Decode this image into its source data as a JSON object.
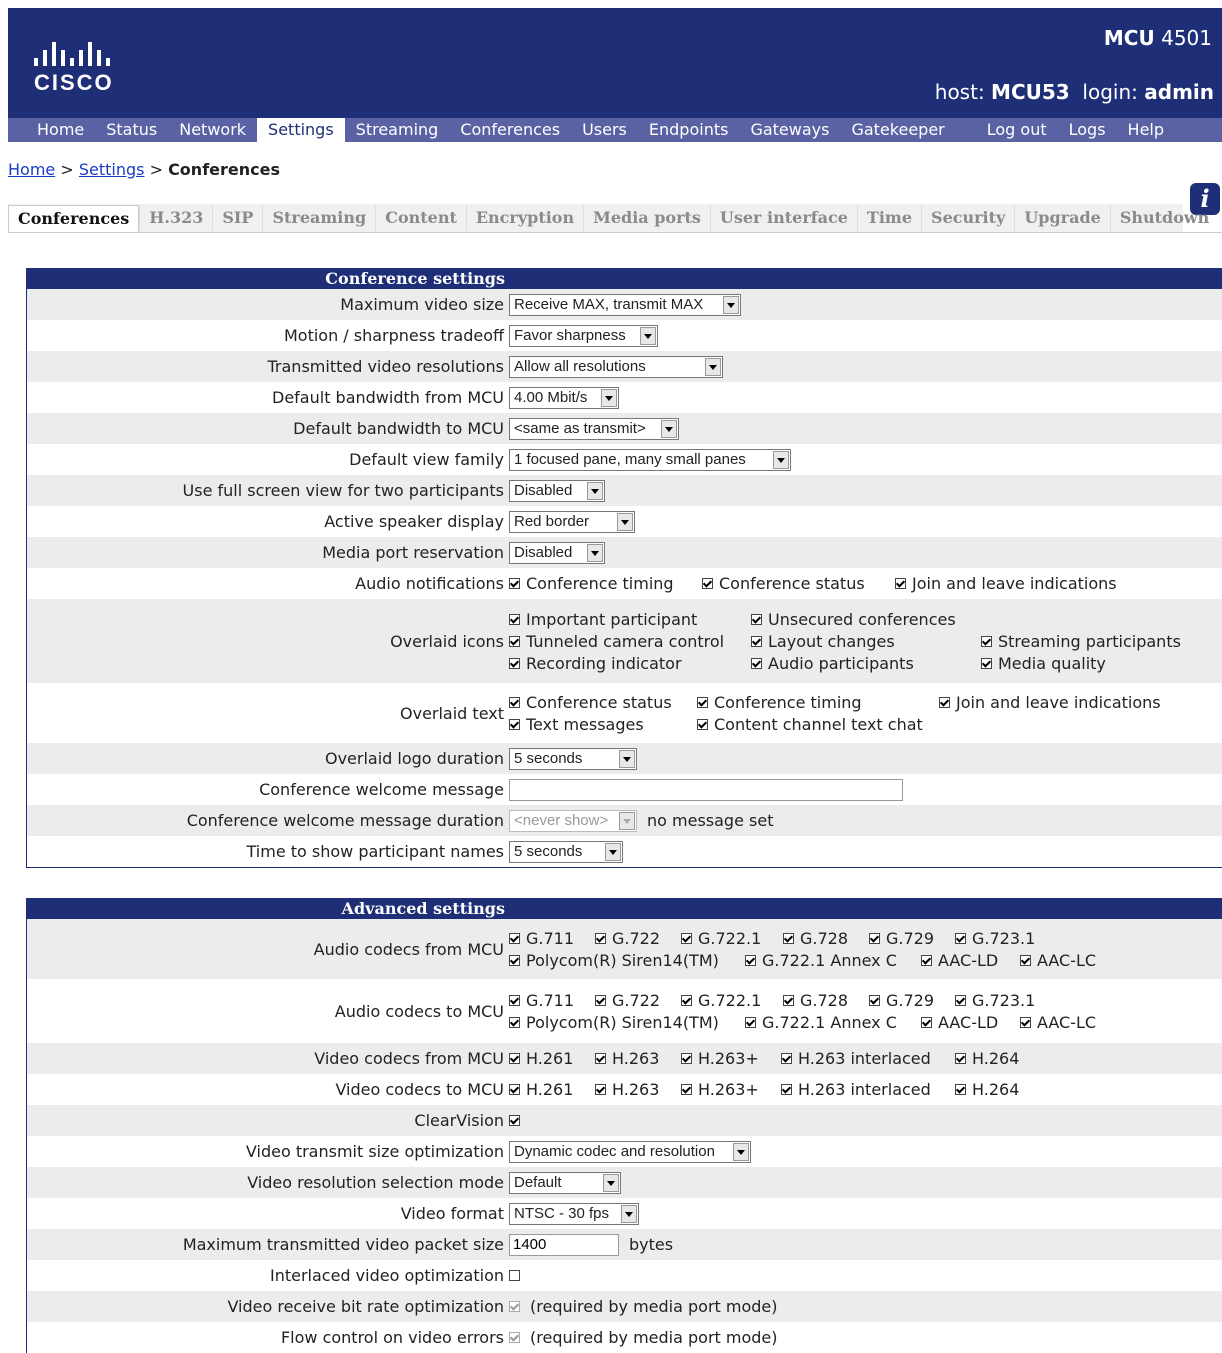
{
  "header": {
    "product_name": "MCU",
    "product_model": "4501",
    "host_label": "host:",
    "host_value": "MCU53",
    "login_label": "login:",
    "login_value": "admin",
    "logo_text": "CISCO"
  },
  "nav": {
    "left": [
      "Home",
      "Status",
      "Network",
      "Settings",
      "Streaming",
      "Conferences",
      "Users",
      "Endpoints",
      "Gateways",
      "Gatekeeper"
    ],
    "right": [
      "Log out",
      "Logs",
      "Help"
    ],
    "active": "Settings"
  },
  "breadcrumb": {
    "home": "Home",
    "settings": "Settings",
    "current": "Conferences",
    "sep": ">"
  },
  "tabs": [
    "Conferences",
    "H.323",
    "SIP",
    "Streaming",
    "Content",
    "Encryption",
    "Media ports",
    "User interface",
    "Time",
    "Security",
    "Upgrade",
    "Shutdown"
  ],
  "conference_settings": {
    "title": "Conference settings",
    "max_video_size": {
      "label": "Maximum video size",
      "value": "Receive MAX, transmit MAX"
    },
    "motion_tradeoff": {
      "label": "Motion / sharpness tradeoff",
      "value": "Favor sharpness"
    },
    "tx_resolutions": {
      "label": "Transmitted video resolutions",
      "value": "Allow all resolutions"
    },
    "bw_from": {
      "label": "Default bandwidth from MCU",
      "value": "4.00 Mbit/s"
    },
    "bw_to": {
      "label": "Default bandwidth to MCU",
      "value": "<same as transmit>"
    },
    "view_family": {
      "label": "Default view family",
      "value": "1 focused pane, many small panes"
    },
    "full_screen": {
      "label": "Use full screen view for two participants",
      "value": "Disabled"
    },
    "active_speaker": {
      "label": "Active speaker display",
      "value": "Red border"
    },
    "media_port": {
      "label": "Media port reservation",
      "value": "Disabled"
    },
    "audio_notifications": {
      "label": "Audio notifications",
      "a": "Conference timing",
      "b": "Conference status",
      "c": "Join and leave indications"
    },
    "overlaid_icons": {
      "label": "Overlaid icons",
      "i1": "Important participant",
      "i2": "Unsecured conferences",
      "i3": "Tunneled camera control",
      "i4": "Layout changes",
      "i5": "Streaming participants",
      "i6": "Recording indicator",
      "i7": "Audio participants",
      "i8": "Media quality"
    },
    "overlaid_text": {
      "label": "Overlaid text",
      "t1": "Conference status",
      "t2": "Conference timing",
      "t3": "Join and leave indications",
      "t4": "Text messages",
      "t5": "Content channel text chat"
    },
    "logo_duration": {
      "label": "Overlaid logo duration",
      "value": "5 seconds"
    },
    "welcome_msg": {
      "label": "Conference welcome message",
      "value": ""
    },
    "welcome_duration": {
      "label": "Conference welcome message duration",
      "value": "<never show>",
      "note": "no message set"
    },
    "names_time": {
      "label": "Time to show participant names",
      "value": "5 seconds"
    }
  },
  "advanced_settings": {
    "title": "Advanced settings",
    "audio_from": {
      "label": "Audio codecs from MCU"
    },
    "audio_to": {
      "label": "Audio codecs to MCU"
    },
    "audio_codecs": {
      "c1": "G.711",
      "c2": "G.722",
      "c3": "G.722.1",
      "c4": "G.728",
      "c5": "G.729",
      "c6": "G.723.1",
      "c7": "Polycom(R) Siren14(TM)",
      "c8": "G.722.1 Annex C",
      "c9": "AAC-LD",
      "c10": "AAC-LC"
    },
    "video_from": {
      "label": "Video codecs from MCU"
    },
    "video_to": {
      "label": "Video codecs to MCU"
    },
    "video_codecs": {
      "v1": "H.261",
      "v2": "H.263",
      "v3": "H.263+",
      "v4": "H.263 interlaced",
      "v5": "H.264"
    },
    "clearvision": {
      "label": "ClearVision"
    },
    "tx_size_opt": {
      "label": "Video transmit size optimization",
      "value": "Dynamic codec and resolution"
    },
    "res_mode": {
      "label": "Video resolution selection mode",
      "value": "Default"
    },
    "video_format": {
      "label": "Video format",
      "value": "NTSC - 30 fps"
    },
    "max_packet": {
      "label": "Maximum transmitted video packet size",
      "value": "1400",
      "unit": "bytes"
    },
    "interlaced": {
      "label": "Interlaced video optimization"
    },
    "rx_bitrate": {
      "label": "Video receive bit rate optimization",
      "note": "(required by media port mode)"
    },
    "flow_control": {
      "label": "Flow control on video errors",
      "note": "(required by media port mode)"
    }
  }
}
